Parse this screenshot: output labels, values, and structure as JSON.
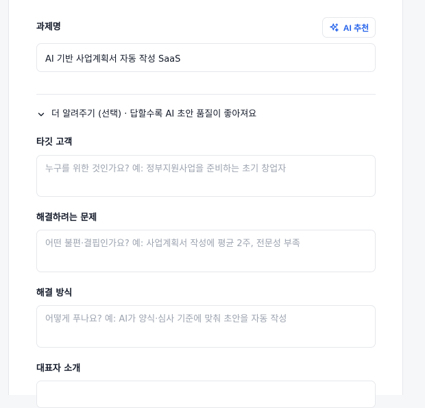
{
  "project_name": {
    "label": "과제명",
    "value": "AI 기반 사업계획서 자동 작성 SaaS",
    "ai_button_label": "AI 추천"
  },
  "more_toggle": {
    "label": "더 알려주기 (선택) · 답할수록 AI 초안 품질이 좋아져요"
  },
  "fields": [
    {
      "label": "타깃 고객",
      "placeholder": "누구를 위한 것인가요? 예: 정부지원사업을 준비하는 초기 창업자"
    },
    {
      "label": "해결하려는 문제",
      "placeholder": "어떤 불편·결핍인가요? 예: 사업계획서 작성에 평균 2주, 전문성 부족"
    },
    {
      "label": "해결 방식",
      "placeholder": "어떻게 푸나요? 예: AI가 양식·심사 기준에 맞춰 초안을 자동 작성"
    },
    {
      "label": "대표자 소개",
      "placeholder": ""
    }
  ],
  "colors": {
    "accent": "#2563eb",
    "border": "#e5e7eb",
    "placeholder": "#9ca3af"
  }
}
